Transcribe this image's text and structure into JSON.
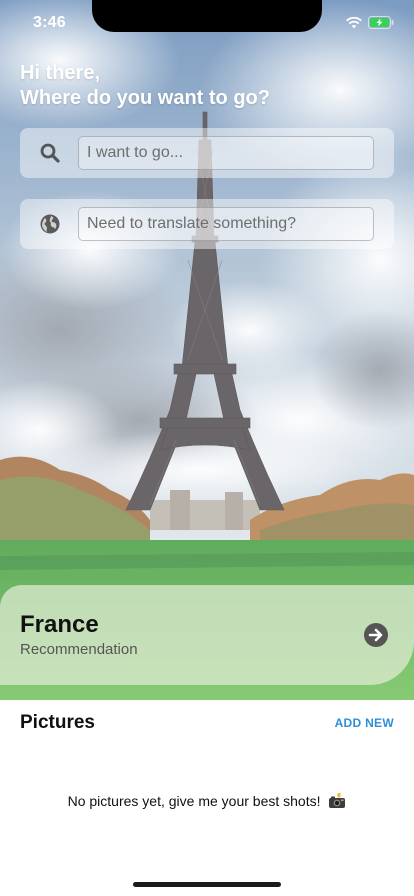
{
  "status_bar": {
    "time": "3:46",
    "icons": [
      "wifi-icon",
      "battery-charging-icon"
    ]
  },
  "greeting": {
    "line1": "Hi there,",
    "line2": "Where do you want to go?"
  },
  "search": {
    "icon": "search-icon",
    "placeholder": "I want to go..."
  },
  "translate": {
    "icon": "globe-icon",
    "placeholder": "Need to translate something?"
  },
  "recommendation": {
    "country": "France",
    "subtitle": "Recommendation",
    "arrow_icon": "arrow-right-circle-icon"
  },
  "pictures": {
    "title": "Pictures",
    "add_label": "ADD NEW",
    "empty_message": "No pictures yet, give me your best shots!",
    "empty_icon": "camera-flash-icon"
  },
  "colors": {
    "accent": "#2d8fd6",
    "text": "#111111",
    "muted": "#555555"
  }
}
